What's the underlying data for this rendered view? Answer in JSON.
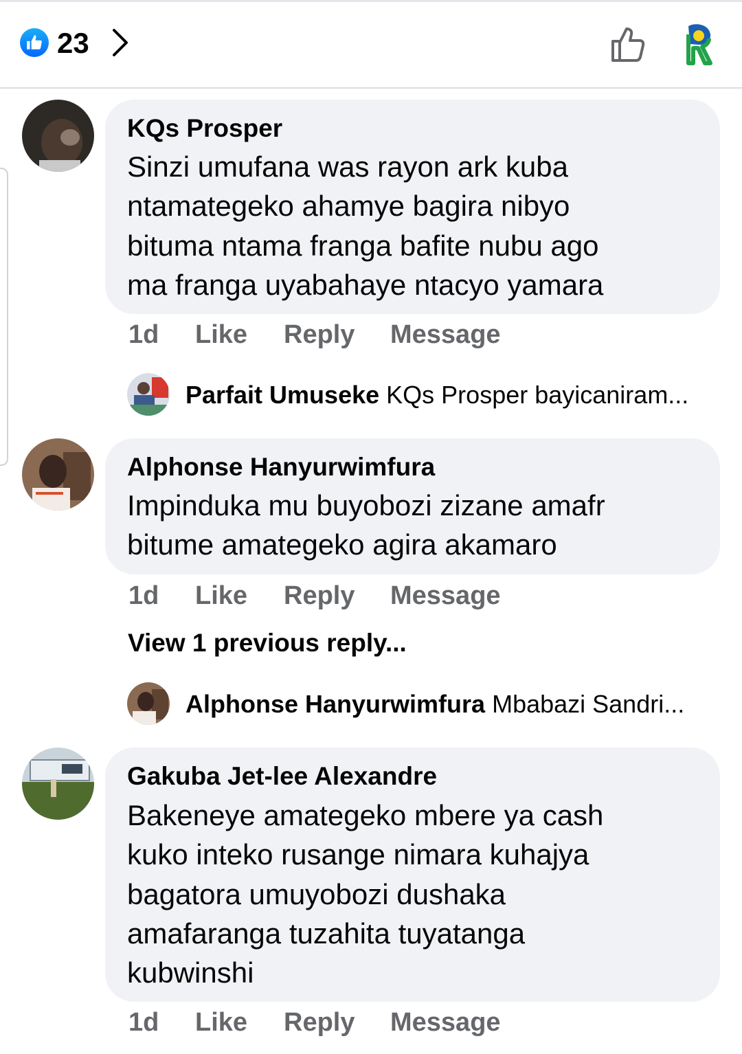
{
  "header": {
    "reaction_count": "23",
    "like_icon": "thumbs-up-icon",
    "brand_color": "#0866ff"
  },
  "comments": [
    {
      "author": "KQs Prosper",
      "lines": [
        "Sinzi umufana was rayon ark kuba",
        "ntamategeko ahamye bagira nibyo",
        "bituma ntama franga  bafite nubu ago",
        "ma franga  uyabahaye ntacyo yamara"
      ],
      "time": "1d",
      "like": "Like",
      "reply": "Reply",
      "message": "Message",
      "reply_preview": {
        "author": "Parfait Umuseke",
        "text": "KQs Prosper bayicaniram..."
      }
    },
    {
      "author": "Alphonse Hanyurwimfura",
      "lines": [
        "Impinduka mu buyobozi zizane amafr",
        "bitume amategeko agira akamaro"
      ],
      "time": "1d",
      "like": "Like",
      "reply": "Reply",
      "message": "Message",
      "view_previous": "View 1 previous reply...",
      "reply_preview": {
        "author": "Alphonse Hanyurwimfura",
        "text": "Mbabazi Sandri..."
      }
    },
    {
      "author": "Gakuba Jet-lee Alexandre",
      "lines": [
        "Bakeneye amategeko mbere ya cash",
        "kuko inteko rusange nimara kuhajya",
        "bagatora umuyobozi dushaka",
        "amafaranga tuzahita tuyatanga",
        "kubwinshi"
      ],
      "time": "1d",
      "like": "Like",
      "reply": "Reply",
      "message": "Message"
    }
  ]
}
